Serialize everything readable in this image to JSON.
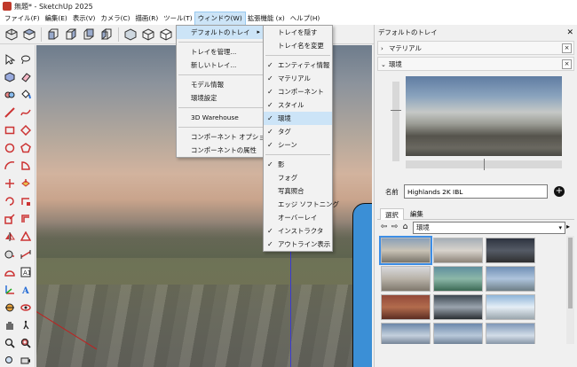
{
  "window": {
    "title": "無題* - SketchUp 2025"
  },
  "menubar": {
    "items": [
      {
        "label": "ファイル(F)"
      },
      {
        "label": "編集(E)"
      },
      {
        "label": "表示(V)"
      },
      {
        "label": "カメラ(C)"
      },
      {
        "label": "描画(R)"
      },
      {
        "label": "ツール(T)"
      },
      {
        "label": "ウィンドウ(W)"
      },
      {
        "label": "拡張機能 (x)"
      },
      {
        "label": "ヘルプ(H)"
      }
    ],
    "active_index": 6
  },
  "toolbar": {
    "icons": [
      "iso-view-icon",
      "top-view-icon",
      "front-view-icon",
      "right-view-icon",
      "back-view-icon",
      "left-view-icon",
      "xray-style-icon",
      "wireframe-style-icon",
      "hidden-line-style-icon",
      "shaded-style-icon",
      "shaded-texture-style-icon",
      "monochrome-style-icon"
    ]
  },
  "window_menu": {
    "items": [
      {
        "label": "デフォルトのトレイ",
        "submenu": true,
        "highlight": true
      },
      {
        "sep": true
      },
      {
        "label": "トレイを管理..."
      },
      {
        "label": "新しいトレイ..."
      },
      {
        "sep": true
      },
      {
        "label": "モデル情報"
      },
      {
        "label": "環境設定"
      },
      {
        "sep": true
      },
      {
        "label": "3D Warehouse"
      },
      {
        "sep": true
      },
      {
        "label": "コンポーネント オプション"
      },
      {
        "label": "コンポーネントの属性"
      }
    ]
  },
  "trays_submenu": {
    "items": [
      {
        "label": "トレイを隠す",
        "checked": false
      },
      {
        "label": "トレイ名を変更",
        "checked": false
      },
      {
        "sep": true
      },
      {
        "label": "エンティティ情報",
        "checked": true
      },
      {
        "label": "マテリアル",
        "checked": true
      },
      {
        "label": "コンポーネント",
        "checked": true
      },
      {
        "label": "スタイル",
        "checked": true
      },
      {
        "label": "環境",
        "checked": true,
        "highlight": true
      },
      {
        "label": "タグ",
        "checked": true
      },
      {
        "label": "シーン",
        "checked": true
      },
      {
        "sep": true
      },
      {
        "label": "影",
        "checked": true
      },
      {
        "label": "フォグ",
        "checked": false
      },
      {
        "label": "写真照合",
        "checked": false
      },
      {
        "label": "エッジ ソフトニング",
        "checked": false
      },
      {
        "label": "オーバーレイ",
        "checked": false
      },
      {
        "label": "インストラクタ",
        "checked": true
      },
      {
        "label": "アウトライン表示",
        "checked": true
      }
    ]
  },
  "tray": {
    "title": "デフォルトのトレイ",
    "panels": [
      {
        "label": "マテリアル",
        "expanded": false
      },
      {
        "label": "環境",
        "expanded": true
      }
    ],
    "environment": {
      "name_label": "名前",
      "name_value": "Highlands 2K IBL",
      "tabs": [
        {
          "label": "選択",
          "active": true
        },
        {
          "label": "編集",
          "active": false
        }
      ],
      "collection": "環境",
      "thumbnail_count": 20
    }
  },
  "colors": {
    "accent": "#3d8ee6",
    "menu_highlight": "#cce4f7",
    "figure": "#3b8fd6",
    "blue_axis": "#3a3ad0",
    "red_axis": "#c02020"
  }
}
